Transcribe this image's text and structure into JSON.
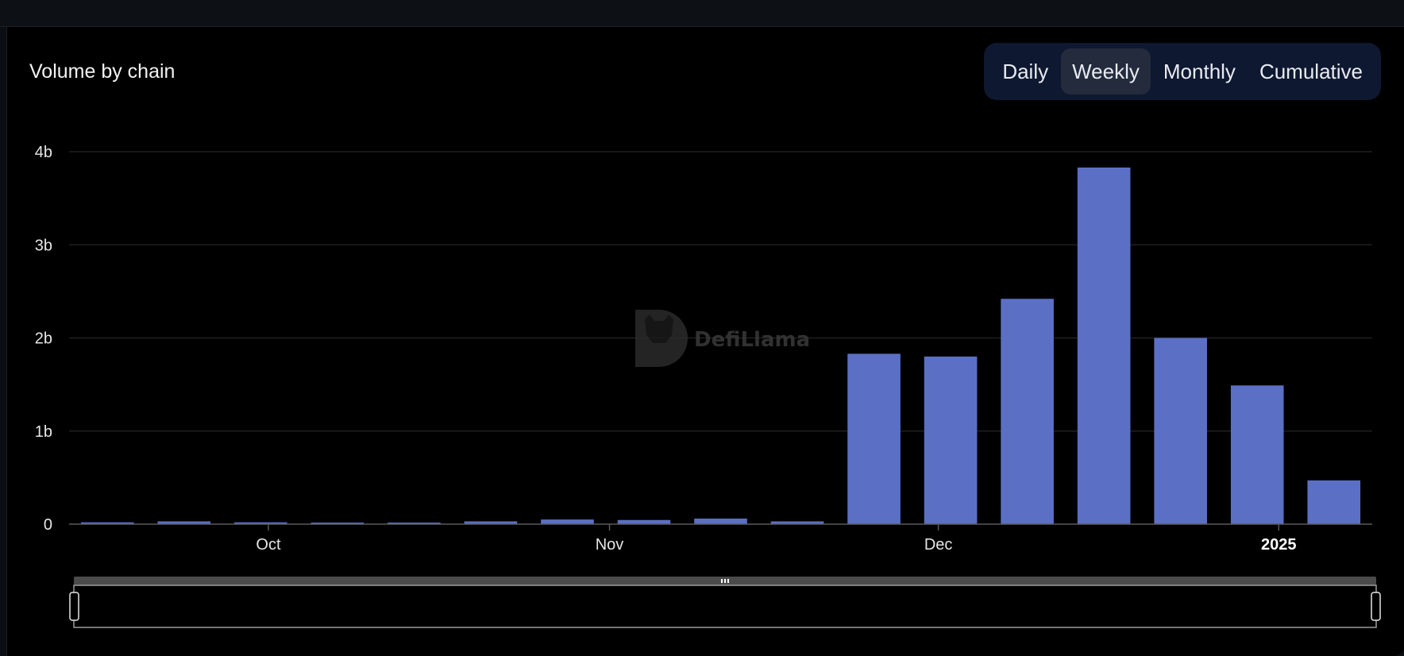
{
  "header": {
    "title": "Volume by chain"
  },
  "tabs": [
    {
      "label": "Daily",
      "active": false
    },
    {
      "label": "Weekly",
      "active": true
    },
    {
      "label": "Monthly",
      "active": false
    },
    {
      "label": "Cumulative",
      "active": false
    }
  ],
  "watermark": {
    "text": "DefiLlama"
  },
  "chart_data": {
    "type": "bar",
    "title": "Volume by chain",
    "y_ticks": [
      "0",
      "1b",
      "2b",
      "3b",
      "4b"
    ],
    "ylim": [
      0,
      4000000000
    ],
    "x_ticks": [
      {
        "label": "Oct",
        "bold": false,
        "position": 2.6
      },
      {
        "label": "Nov",
        "bold": false,
        "position": 7.05
      },
      {
        "label": "Dec",
        "bold": false,
        "position": 11.34
      },
      {
        "label": "2025",
        "bold": true,
        "position": 15.78
      }
    ],
    "values": [
      20000000,
      30000000,
      20000000,
      10000000,
      15000000,
      30000000,
      50000000,
      45000000,
      60000000,
      30000000,
      1830000000,
      1800000000,
      2420000000,
      3830000000,
      2000000000,
      1490000000,
      470000000
    ],
    "colors": {
      "bar": "#5b70c4",
      "grid": "#1f1f1f",
      "axis": "#5a5a5a"
    },
    "grid": true,
    "legend": "none"
  },
  "range_slider": {
    "handle_icon": "grip-icon"
  }
}
